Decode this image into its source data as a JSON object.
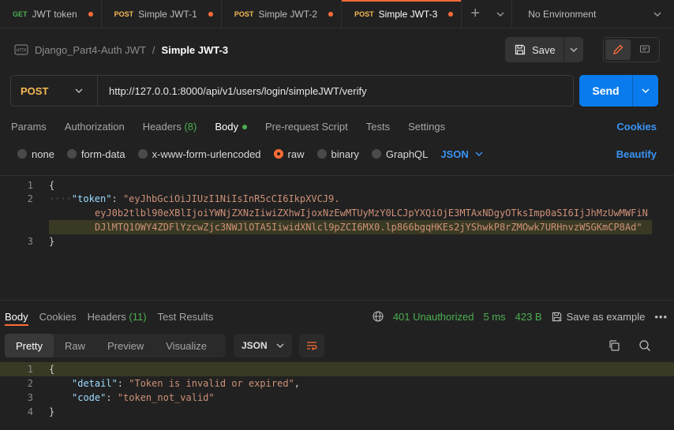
{
  "tabs": [
    {
      "method": "GET",
      "name": "JWT token",
      "active": false
    },
    {
      "method": "POST",
      "name": "Simple JWT-1",
      "active": false
    },
    {
      "method": "POST",
      "name": "Simple JWT-2",
      "active": false
    },
    {
      "method": "POST",
      "name": "Simple JWT-3",
      "active": true
    }
  ],
  "environment": "No Environment",
  "breadcrumb": {
    "collection": "Django_Part4-Auth JWT",
    "separator": "/",
    "request": "Simple JWT-3"
  },
  "save_label": "Save",
  "request": {
    "method": "POST",
    "url": "http://127.0.0.1:8000/api/v1/users/login/simpleJWT/verify",
    "send_label": "Send"
  },
  "request_tabs": {
    "params": "Params",
    "authorization": "Authorization",
    "headers": "Headers",
    "headers_count": "(8)",
    "body": "Body",
    "prerequest": "Pre-request Script",
    "tests": "Tests",
    "settings": "Settings",
    "cookies": "Cookies"
  },
  "body_types": {
    "none": "none",
    "form_data": "form-data",
    "urlencoded": "x-www-form-urlencoded",
    "raw": "raw",
    "binary": "binary",
    "graphql": "GraphQL",
    "json": "JSON",
    "beautify": "Beautify"
  },
  "request_body": {
    "line_numbers": [
      "1",
      "2",
      "3"
    ],
    "open_brace": "{",
    "close_brace": "}",
    "indent_dots": "····",
    "key": "\"token\"",
    "colon": ": ",
    "value_1": "\"eyJhbGciOiJIUzI1NiIsInR5cCI6IkpXVCJ9.",
    "value_2": "eyJ0b2tlbl90eXBlIjoiYWNjZXNzIiwiZXhwIjoxNzEwMTUyMzY0LCJpYXQiOjE3MTAxNDgyOTksImp0aSI6IjJhMzUwMWFiN",
    "value_3": "DJlMTQ1OWY4ZDFlYzcwZjc3NWJlOTA5IiwidXNlcl9pZCI6MX0.lp866bgqHKEs2jYShwkP8rZMOwk7URHnvzW5GKmCP8Ad\""
  },
  "response_tabs": {
    "body": "Body",
    "cookies": "Cookies",
    "headers": "Headers",
    "headers_count": "(11)",
    "test_results": "Test Results"
  },
  "response_meta": {
    "status": "401 Unauthorized",
    "time": "5 ms",
    "size": "423 B",
    "save_example": "Save as example",
    "more": "•••"
  },
  "view_modes": {
    "pretty": "Pretty",
    "raw": "Raw",
    "preview": "Preview",
    "visualize": "Visualize",
    "format": "JSON"
  },
  "response_body": {
    "line_numbers": [
      "1",
      "2",
      "3",
      "4"
    ],
    "open_brace": "{",
    "close_brace": "}",
    "detail_key": "\"detail\"",
    "detail_value": "\"Token is invalid or expired\"",
    "code_key": "\"code\"",
    "code_value": "\"token_not_valid\""
  },
  "colors": {
    "accent": "#ff6c37",
    "send": "#097bed",
    "post": "#f7b955",
    "get": "#4caf50",
    "link": "#3a94f5",
    "status": "#4caf50"
  }
}
